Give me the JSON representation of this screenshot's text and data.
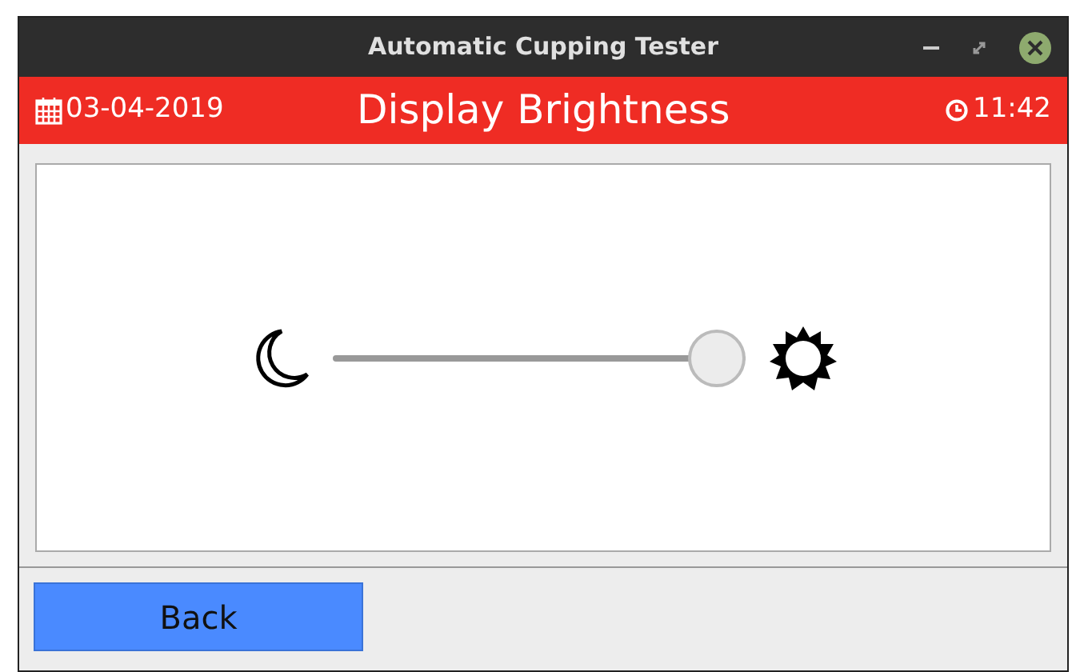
{
  "window": {
    "title": "Automatic Cupping Tester"
  },
  "header": {
    "date": "03-04-2019",
    "title": "Display Brightness",
    "time": "11:42"
  },
  "brightness": {
    "level": 1
  },
  "buttons": [
    {
      "label": "Back"
    }
  ]
}
